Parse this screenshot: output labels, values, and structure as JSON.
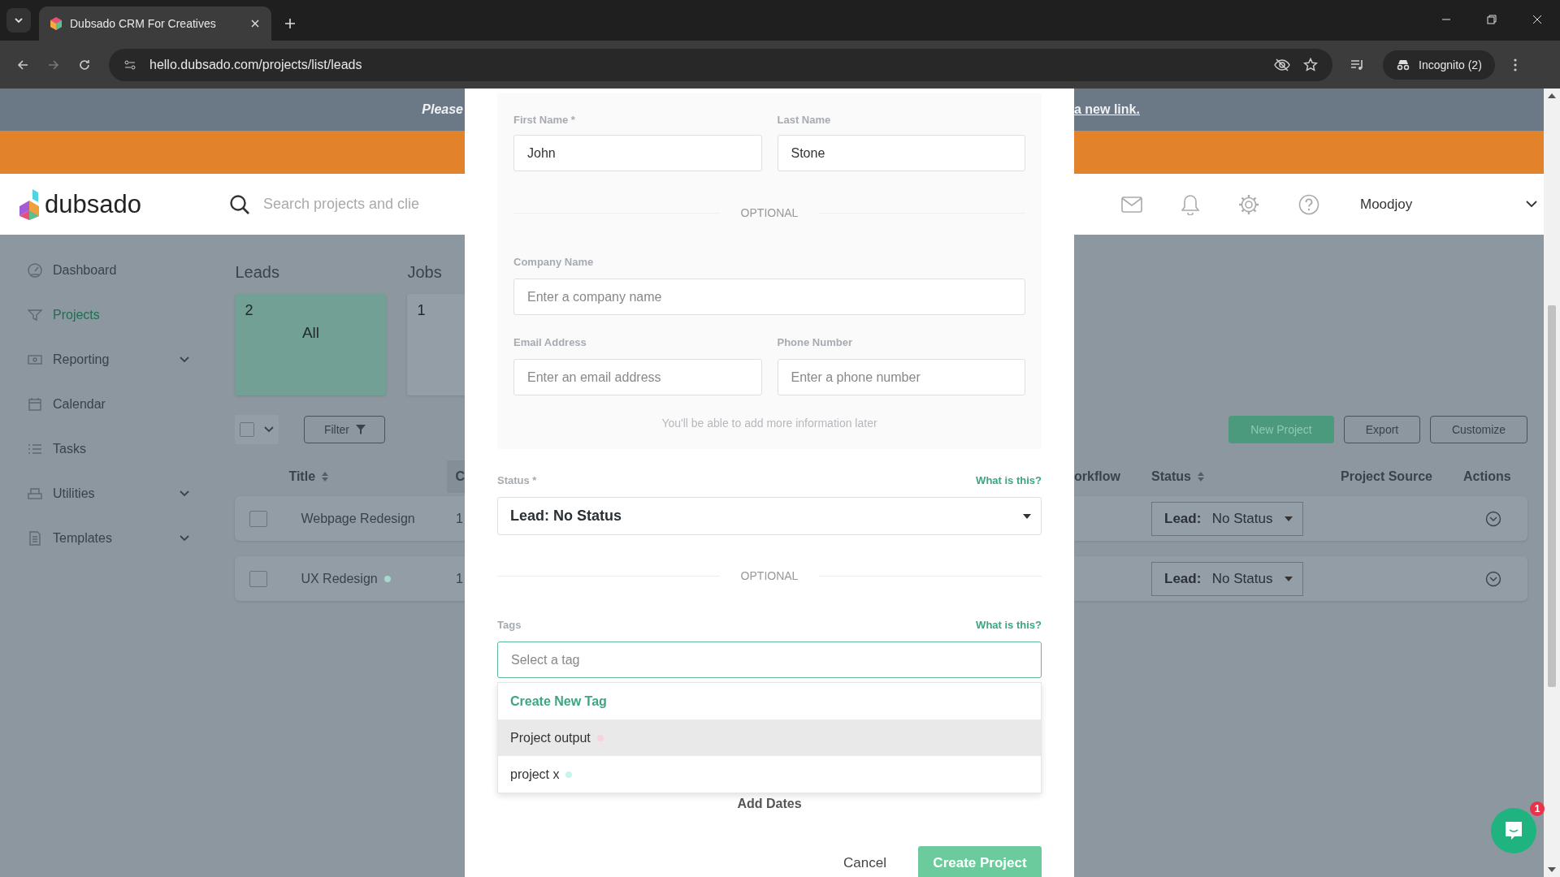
{
  "browser": {
    "tab_title": "Dubsado CRM For Creatives",
    "url": "hello.dubsado.com/projects/list/leads",
    "profile": "Incognito (2)"
  },
  "banner": {
    "text": "Please",
    "link": "a new link."
  },
  "header": {
    "logo": "dubsado",
    "search_placeholder": "Search projects and clie",
    "user": "Moodjoy"
  },
  "sidebar": {
    "items": [
      {
        "label": "Dashboard",
        "selected": false,
        "expandable": false
      },
      {
        "label": "Projects",
        "selected": true,
        "expandable": false
      },
      {
        "label": "Reporting",
        "selected": false,
        "expandable": true
      },
      {
        "label": "Calendar",
        "selected": false,
        "expandable": false
      },
      {
        "label": "Tasks",
        "selected": false,
        "expandable": false
      },
      {
        "label": "Utilities",
        "selected": false,
        "expandable": true
      },
      {
        "label": "Templates",
        "selected": false,
        "expandable": true
      }
    ]
  },
  "pipeline": {
    "groups": [
      {
        "title": "Leads"
      },
      {
        "title": "Jobs"
      }
    ],
    "cards": [
      {
        "count": "2",
        "label": "All",
        "selected": true
      },
      {
        "count": "1",
        "selected": false
      }
    ]
  },
  "toolbar": {
    "filter": "Filter",
    "buttons": [
      {
        "label": "New Project",
        "kind": "primary"
      },
      {
        "label": "Export",
        "kind": "outline"
      },
      {
        "label": "Customize",
        "kind": "outline"
      }
    ]
  },
  "table": {
    "columns_left": [
      {
        "label": "Title",
        "sortable": true
      },
      {
        "label": "C",
        "sortable": false
      }
    ],
    "columns_right": [
      {
        "label": "orkflow",
        "sortable": false
      },
      {
        "label": "Status",
        "sortable": true
      },
      {
        "label": "Project Source",
        "sortable": false
      },
      {
        "label": "Actions",
        "sortable": false
      }
    ],
    "rows": [
      {
        "title": "Webpage Redesign",
        "checked": false,
        "column_2": "1",
        "status_prefix": "Lead:",
        "status": "No Status"
      },
      {
        "title": "UX Redesign",
        "checked": false,
        "color": "#a6d8cc",
        "column_2": "1",
        "status_prefix": "Lead:",
        "status": "No Status"
      }
    ]
  },
  "modal": {
    "name_fields": [
      {
        "label": "First Name *",
        "value": "John"
      },
      {
        "label": "Last Name",
        "value": "Stone"
      }
    ],
    "optional_divider": "OPTIONAL",
    "company_field": {
      "label": "Company Name",
      "placeholder": "Enter a company name"
    },
    "contact_fields": [
      {
        "label": "Email Address",
        "placeholder": "Enter an email address"
      },
      {
        "label": "Phone Number",
        "placeholder": "Enter a phone number"
      }
    ],
    "hint": "You'll be able to add more information later",
    "status": {
      "label": "Status *",
      "help": "What is this?",
      "value": "Lead: No Status"
    },
    "optional_divider_2": "OPTIONAL",
    "tags": {
      "label": "Tags",
      "help": "What is this?",
      "placeholder": "Select a tag",
      "create": "Create New Tag",
      "options": [
        {
          "label": "Project output",
          "color": "#f9d3dc",
          "highlighted": true
        },
        {
          "label": "project x",
          "color": "#c9f3ec",
          "highlighted": false
        }
      ]
    },
    "add_dates": "Add Dates",
    "cancel": "Cancel",
    "submit": "Create Project"
  },
  "chat": {
    "badge": "1"
  }
}
